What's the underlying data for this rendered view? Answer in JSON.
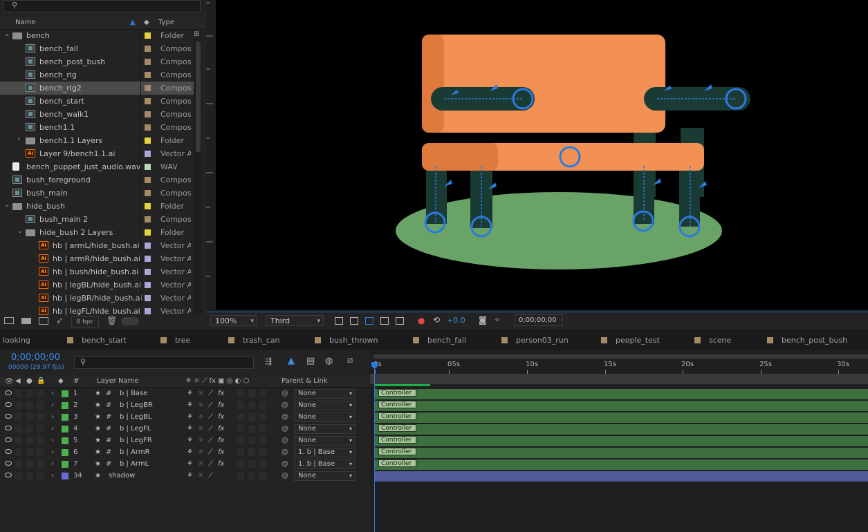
{
  "project": {
    "columns": {
      "name": "Name",
      "type": "Type"
    },
    "items": [
      {
        "name": "bench",
        "icon": "folder",
        "level": 0,
        "twirl": "open",
        "label_color": "#e5d33b",
        "type": "Folder"
      },
      {
        "name": "bench_fall",
        "icon": "comp",
        "level": 1,
        "label_color": "#a58a66",
        "type": "Composi"
      },
      {
        "name": "bench_post_bush",
        "icon": "comp",
        "level": 1,
        "label_color": "#a58a66",
        "type": "Composi"
      },
      {
        "name": "bench_rig",
        "icon": "comp",
        "level": 1,
        "label_color": "#a58a66",
        "type": "Composi"
      },
      {
        "name": "bench_rig2",
        "icon": "comp",
        "level": 1,
        "label_color": "#a58a66",
        "type": "Composi",
        "selected": true
      },
      {
        "name": "bench_start",
        "icon": "comp",
        "level": 1,
        "label_color": "#a58a66",
        "type": "Composi"
      },
      {
        "name": "bench_walk1",
        "icon": "comp",
        "level": 1,
        "label_color": "#a58a66",
        "type": "Composi"
      },
      {
        "name": "bench1.1",
        "icon": "comp",
        "level": 1,
        "label_color": "#a58a66",
        "type": "Composi"
      },
      {
        "name": "bench1.1 Layers",
        "icon": "folder",
        "level": 1,
        "twirl": "closed",
        "label_color": "#e5d33b",
        "type": "Folder"
      },
      {
        "name": "Layer 9/bench1.1.ai",
        "icon": "ai",
        "level": 1,
        "label_color": "#a8a8d8",
        "type": "Vector Ar"
      },
      {
        "name": "bench_puppet_just_audio.wav",
        "icon": "wav",
        "level": 0,
        "label_color": "#b8d8b8",
        "type": "WAV"
      },
      {
        "name": "bush_foreground",
        "icon": "comp",
        "level": 0,
        "label_color": "#a58a66",
        "type": "Composi"
      },
      {
        "name": "bush_main",
        "icon": "comp",
        "level": 0,
        "label_color": "#a58a66",
        "type": "Composi"
      },
      {
        "name": "hide_bush",
        "icon": "folder",
        "level": 0,
        "twirl": "open",
        "label_color": "#e5d33b",
        "type": "Folder"
      },
      {
        "name": "bush_main 2",
        "icon": "comp",
        "level": 1,
        "label_color": "#a58a66",
        "type": "Composi"
      },
      {
        "name": "hide_bush 2 Layers",
        "icon": "folder",
        "level": 1,
        "twirl": "open",
        "label_color": "#e5d33b",
        "type": "Folder"
      },
      {
        "name": "hb | armL/hide_bush.ai",
        "icon": "ai",
        "level": 2,
        "label_color": "#a8a8d8",
        "type": "Vector Ar"
      },
      {
        "name": "hb | armR/hide_bush.ai",
        "icon": "ai",
        "level": 2,
        "label_color": "#a8a8d8",
        "type": "Vector Ar"
      },
      {
        "name": "hb | bush/hide_bush.ai",
        "icon": "ai",
        "level": 2,
        "label_color": "#a8a8d8",
        "type": "Vector Ar"
      },
      {
        "name": "hb | legBL/hide_bush.ai",
        "icon": "ai",
        "level": 2,
        "label_color": "#a8a8d8",
        "type": "Vector Ar"
      },
      {
        "name": "hb | legBR/hide_bush.ai",
        "icon": "ai",
        "level": 2,
        "label_color": "#a8a8d8",
        "type": "Vector Ar"
      },
      {
        "name": "hb | legFL/hide_bush.ai",
        "icon": "ai",
        "level": 2,
        "label_color": "#a8a8d8",
        "type": "Vector Ar"
      }
    ],
    "bit_depth": "8 bpc"
  },
  "viewer": {
    "zoom": "100%",
    "camera_view": "Third",
    "exposure": "+0.0",
    "timecode": "0;00;00;00"
  },
  "comp_tabs": [
    "looking",
    "bench_start",
    "tree",
    "trash_can",
    "bush_thrown",
    "bench_fall",
    "person03_run",
    "people_test",
    "scene",
    "bench_post_bush"
  ],
  "timeline": {
    "timecode": "0;00;00;00",
    "frame_info": "00000 (29.97 fps)",
    "headers": {
      "hash": "#",
      "layer_name": "Layer Name",
      "parent_link": "Parent & Link"
    },
    "ruler": [
      "0s",
      "05s",
      "10s",
      "15s",
      "20s",
      "25s",
      "30s"
    ],
    "layers": [
      {
        "num": "1",
        "name": "b | Base",
        "label_color": "#4caf50",
        "parent": "None",
        "bar_label": "Controller"
      },
      {
        "num": "2",
        "name": "b | LegBR",
        "label_color": "#4caf50",
        "parent": "None",
        "bar_label": "Controller"
      },
      {
        "num": "3",
        "name": "b | LegBL",
        "label_color": "#4caf50",
        "parent": "None",
        "bar_label": "Controller"
      },
      {
        "num": "4",
        "name": "b | LegFL",
        "label_color": "#4caf50",
        "parent": "None",
        "bar_label": "Controller"
      },
      {
        "num": "5",
        "name": "b | LegFR",
        "label_color": "#4caf50",
        "parent": "None",
        "bar_label": "Controller"
      },
      {
        "num": "6",
        "name": "b | ArmR",
        "label_color": "#4caf50",
        "parent": "1. b | Base",
        "bar_label": "Controller"
      },
      {
        "num": "7",
        "name": "b | ArmL",
        "label_color": "#4caf50",
        "parent": "1. b | Base",
        "bar_label": "Controller"
      },
      {
        "num": "34",
        "name": "shadow",
        "label_color": "#6a6ad8",
        "parent": "None",
        "bar_label": ""
      }
    ]
  }
}
